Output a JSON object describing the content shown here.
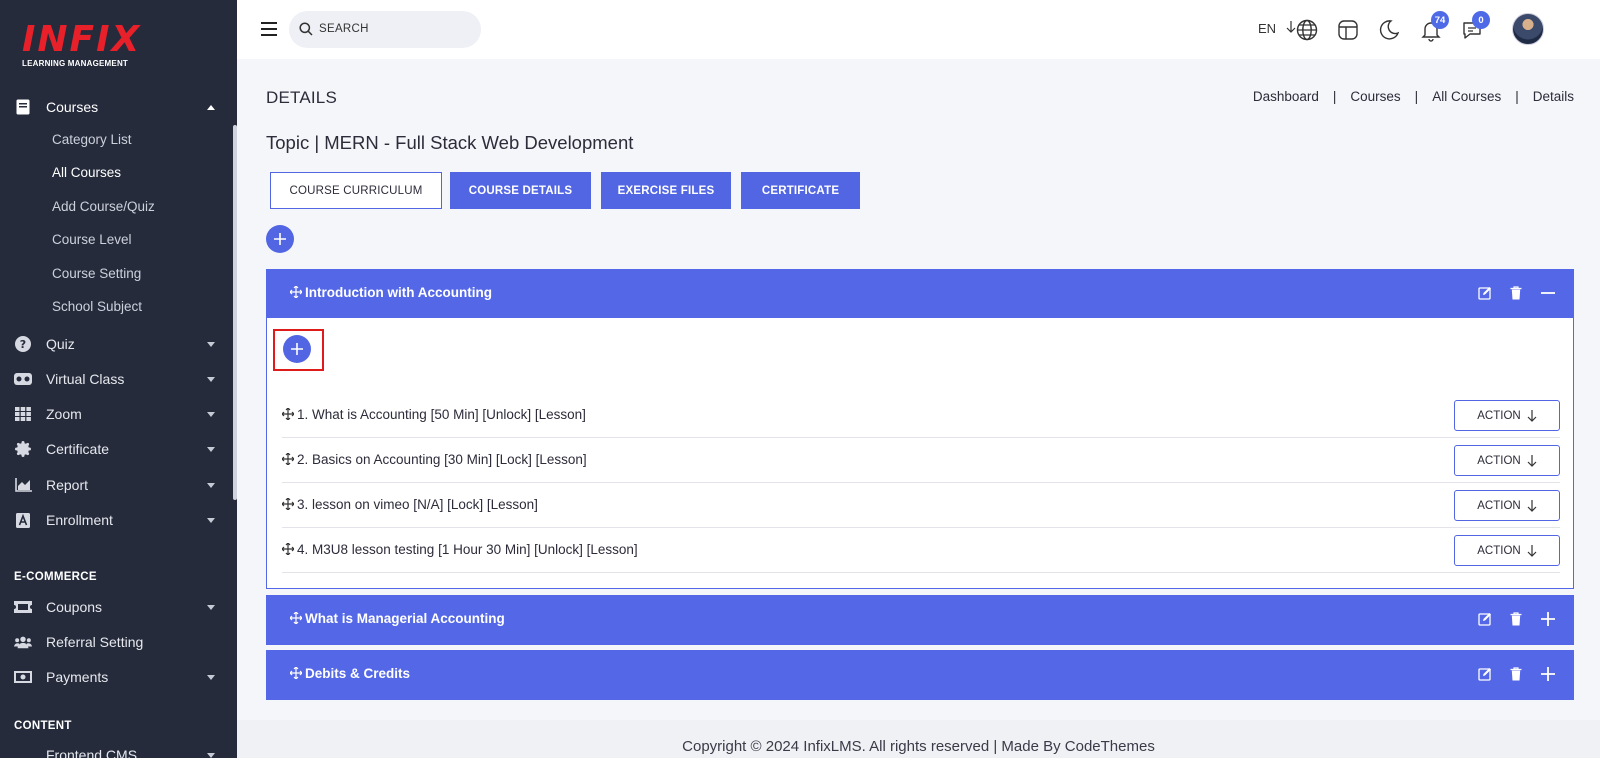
{
  "sidebar": {
    "logo": {
      "main": "INFIX",
      "sub": "LEARNING MANAGEMENT"
    },
    "courses": {
      "label": "Courses",
      "icon": "book-icon"
    },
    "sub_items": [
      {
        "label": "Category List"
      },
      {
        "label": "All Courses"
      },
      {
        "label": "Add Course/Quiz"
      },
      {
        "label": "Course Level"
      },
      {
        "label": "Course Setting"
      },
      {
        "label": "School Subject"
      }
    ],
    "items": [
      {
        "label": "Quiz",
        "icon": "question-icon"
      },
      {
        "label": "Virtual Class",
        "icon": "vr-headset-icon"
      },
      {
        "label": "Zoom",
        "icon": "grid-icon"
      },
      {
        "label": "Certificate",
        "icon": "certificate-icon"
      },
      {
        "label": "Report",
        "icon": "chart-icon"
      },
      {
        "label": "Enrollment",
        "icon": "enrollment-icon"
      }
    ],
    "ecommerce_title": "E-COMMERCE",
    "ecommerce": [
      {
        "label": "Coupons",
        "icon": "ticket-icon"
      },
      {
        "label": "Referral Setting",
        "icon": "users-icon"
      },
      {
        "label": "Payments",
        "icon": "money-icon"
      }
    ],
    "content_title": "CONTENT",
    "content": [
      {
        "label": "Frontend CMS"
      }
    ]
  },
  "header": {
    "search_placeholder": "SEARCH",
    "lang": "EN",
    "notifications_count": "74",
    "messages_count": "0"
  },
  "main": {
    "page_title": "DETAILS",
    "breadcrumb": [
      "Dashboard",
      "Courses",
      "All Courses",
      "Details"
    ],
    "breadcrumb_sep": "|",
    "topic": "Topic | MERN - Full Stack Web Development",
    "tabs": [
      {
        "label": "COURSE CURRICULUM"
      },
      {
        "label": "COURSE DETAILS"
      },
      {
        "label": "EXERCISE FILES"
      },
      {
        "label": "CERTIFICATE"
      }
    ],
    "sections": [
      {
        "title": "Introduction with Accounting"
      },
      {
        "title": "What is Managerial Accounting"
      },
      {
        "title": "Debits & Credits"
      }
    ],
    "lessons": [
      {
        "title": "1. What is Accounting [50 Min] [Unlock] [Lesson]"
      },
      {
        "title": "2. Basics on Accounting [30 Min] [Lock] [Lesson]"
      },
      {
        "title": "3. lesson on vimeo [N/A] [Lock] [Lesson]"
      },
      {
        "title": "4. M3U8 lesson testing [1 Hour 30 Min] [Unlock] [Lesson]"
      }
    ],
    "action_label": "ACTION"
  },
  "footer": {
    "text": "Copyright © 2024 InfixLMS. All rights reserved | Made By CodeThemes"
  },
  "colors": {
    "primary": "#5468e7",
    "sidebar_bg": "#252b3b",
    "logo_red": "#e8202a",
    "highlight_red": "#e01b1b"
  }
}
